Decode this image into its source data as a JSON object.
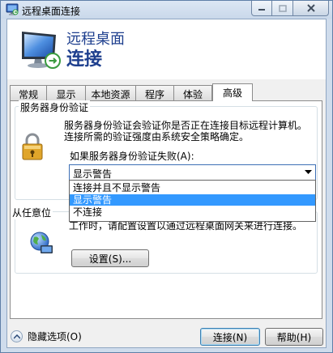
{
  "window": {
    "title": "远程桌面连接"
  },
  "header": {
    "line1": "远程桌面",
    "line2": "连接"
  },
  "tabs": [
    {
      "label": "常规"
    },
    {
      "label": "显示"
    },
    {
      "label": "本地资源"
    },
    {
      "label": "程序"
    },
    {
      "label": "体验"
    },
    {
      "label": "高级"
    }
  ],
  "active_tab": "高级",
  "server_auth": {
    "legend": "服务器身份验证",
    "description": "服务器身份验证会验证你是否正在连接目标远程计算机。连接所需的验证强度由系统安全策略确定。",
    "dropdown_label": "如果服务器身份验证失败(A):",
    "selected_value": "显示警告",
    "options": [
      "连接并且不显示警告",
      "显示警告",
      "不连接"
    ],
    "highlighted_option": "显示警告"
  },
  "gateway": {
    "legend": "从任意位",
    "text": "工作时，请配置设置以通过远程桌面网关来进行连接。",
    "settings_button": "设置(S)..."
  },
  "footer": {
    "hide_options": "隐藏选项(O)",
    "connect_button": "连接(N)",
    "help_button": "帮助(H)"
  },
  "colors": {
    "header_text": "#1e3f8e",
    "selection": "#3399ff",
    "window_frame": "#cfdcec"
  }
}
